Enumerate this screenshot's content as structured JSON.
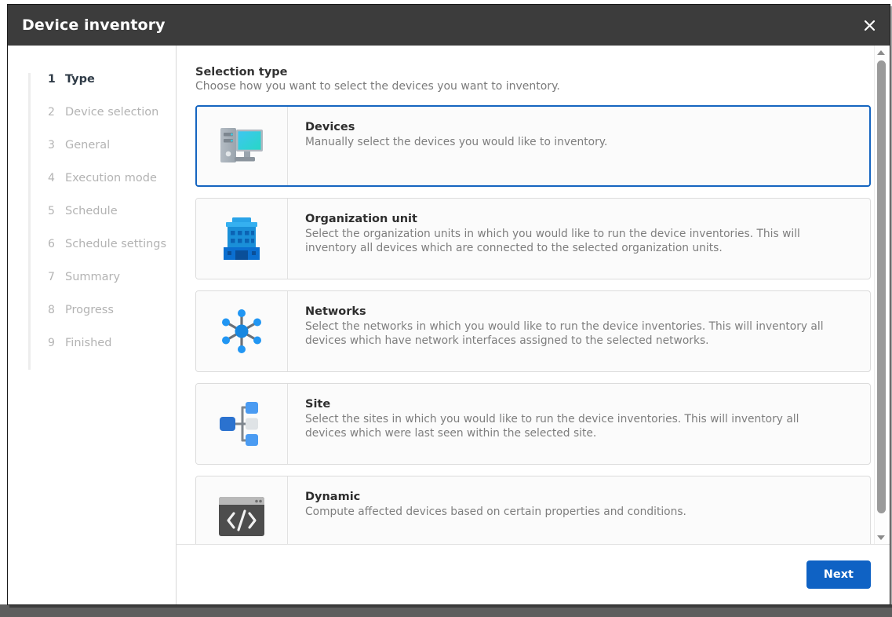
{
  "window": {
    "title": "Device inventory",
    "close_icon": "close-icon"
  },
  "sidebar": {
    "steps": [
      {
        "num": "1",
        "label": "Type",
        "active": true
      },
      {
        "num": "2",
        "label": "Device selection",
        "active": false
      },
      {
        "num": "3",
        "label": "General",
        "active": false
      },
      {
        "num": "4",
        "label": "Execution mode",
        "active": false
      },
      {
        "num": "5",
        "label": "Schedule",
        "active": false
      },
      {
        "num": "6",
        "label": "Schedule settings",
        "active": false
      },
      {
        "num": "7",
        "label": "Summary",
        "active": false
      },
      {
        "num": "8",
        "label": "Progress",
        "active": false
      },
      {
        "num": "9",
        "label": "Finished",
        "active": false
      }
    ]
  },
  "main": {
    "section_title": "Selection type",
    "section_subtitle": "Choose how you want to select the devices you want to inventory.",
    "options": [
      {
        "id": "devices",
        "icon": "desktop-computer-icon",
        "title": "Devices",
        "description": "Manually select the devices you would like to inventory.",
        "selected": true
      },
      {
        "id": "organization-unit",
        "icon": "office-building-icon",
        "title": "Organization unit",
        "description": "Select the organization units in which you would like to run the device inventories. This will inventory all devices which are connected to the selected organization units.",
        "selected": false
      },
      {
        "id": "networks",
        "icon": "network-hub-icon",
        "title": "Networks",
        "description": "Select the networks in which you would like to run the device inventories. This will inventory all devices which have network interfaces assigned to the selected networks.",
        "selected": false
      },
      {
        "id": "site",
        "icon": "site-tree-icon",
        "title": "Site",
        "description": "Select the sites in which you would like to run the device inventories. This will inventory all devices which were last seen within the selected site.",
        "selected": false
      },
      {
        "id": "dynamic",
        "icon": "code-window-icon",
        "title": "Dynamic",
        "description": "Compute affected devices based on certain properties and conditions.",
        "selected": false
      }
    ]
  },
  "footer": {
    "next_label": "Next"
  },
  "scrollbar": {
    "up_icon": "scroll-up-arrow-icon",
    "down_icon": "scroll-down-arrow-icon"
  },
  "colors": {
    "titlebar": "#3c3c3c",
    "accent": "#0f62c4",
    "selected_border": "#1565c0",
    "muted_text": "#b3b3b3",
    "desktop": "#5e5e5e"
  }
}
